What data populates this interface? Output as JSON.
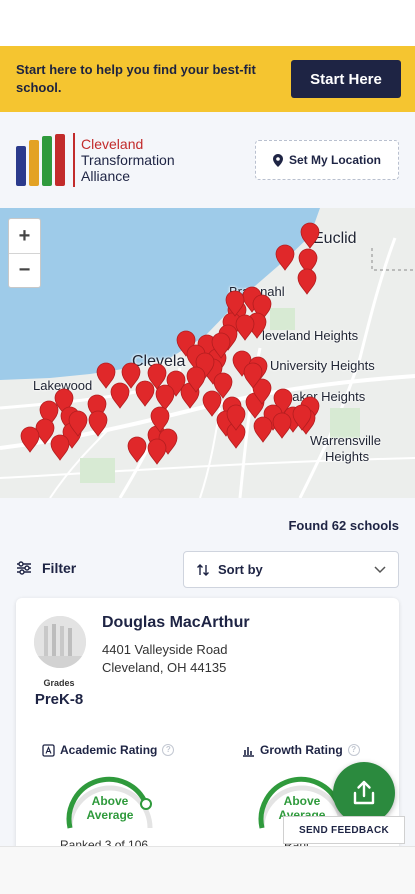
{
  "banner": {
    "text": "Start here to help you find your best-fit school.",
    "button_label": "Start Here",
    "color": "#f5c530"
  },
  "header": {
    "logo_lines": [
      "Cleveland",
      "Transformation",
      "Alliance"
    ],
    "logo_bar_colors": [
      "#2b3a8c",
      "#e3a224",
      "#2f9a3c",
      "#c22b2b"
    ],
    "location_button_label": "Set My Location",
    "location_icon": "map-pin-icon"
  },
  "map": {
    "zoom_in_label": "+",
    "zoom_out_label": "−",
    "labels": {
      "euclid": "Euclid",
      "bratenahl": "Bratenahl",
      "cleveland_heights": "leveland Heights",
      "cleveland": "Clevela",
      "university_heights": "University Heights",
      "lakewood": "Lakewood",
      "shaker_heights": "haker Heights",
      "warrensville": "Warrensville",
      "warrensville2": "Heights"
    },
    "pin_color": "#e0282a"
  },
  "results": {
    "found_text": "Found 62 schools",
    "filter_label": "Filter",
    "sort_label": "Sort by"
  },
  "school": {
    "name": "Douglas MacArthur",
    "address_line1": "4401 Valleyside Road",
    "address_line2": "Cleveland, OH 44135",
    "grades_label": "Grades",
    "grades_value": "PreK-8",
    "academic_rating_label": "Academic Rating",
    "academic_rating_value_1": "Above",
    "academic_rating_value_2": "Average",
    "growth_rating_label": "Growth Rating",
    "growth_rating_value_1": "Above",
    "growth_rating_value_2": "Average",
    "ranked_text": "Ranked 3 of 106",
    "ranked_partial": "Ranl"
  },
  "actions": {
    "feedback_label": "SEND FEEDBACK",
    "share_icon": "share-icon"
  },
  "accent_green": "#2f9a3c"
}
